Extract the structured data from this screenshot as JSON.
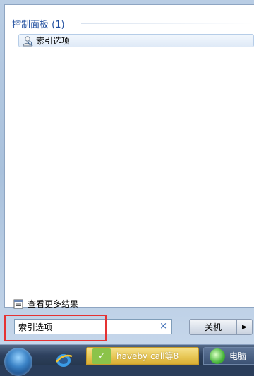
{
  "results": {
    "group_header": "控制面板 (1)",
    "items": [
      {
        "label": "索引选项",
        "icon": "indexing-options-icon"
      }
    ],
    "see_more": "查看更多结果"
  },
  "search": {
    "value": "索引选项",
    "clear": "×"
  },
  "shutdown": {
    "label": "关机",
    "arrow": "▶"
  },
  "taskbar": {
    "active_task_label": "haveby call等8",
    "second_task_label": "电脑"
  },
  "colors": {
    "group_header": "#1e4d9e",
    "highlight": "#e53232"
  }
}
